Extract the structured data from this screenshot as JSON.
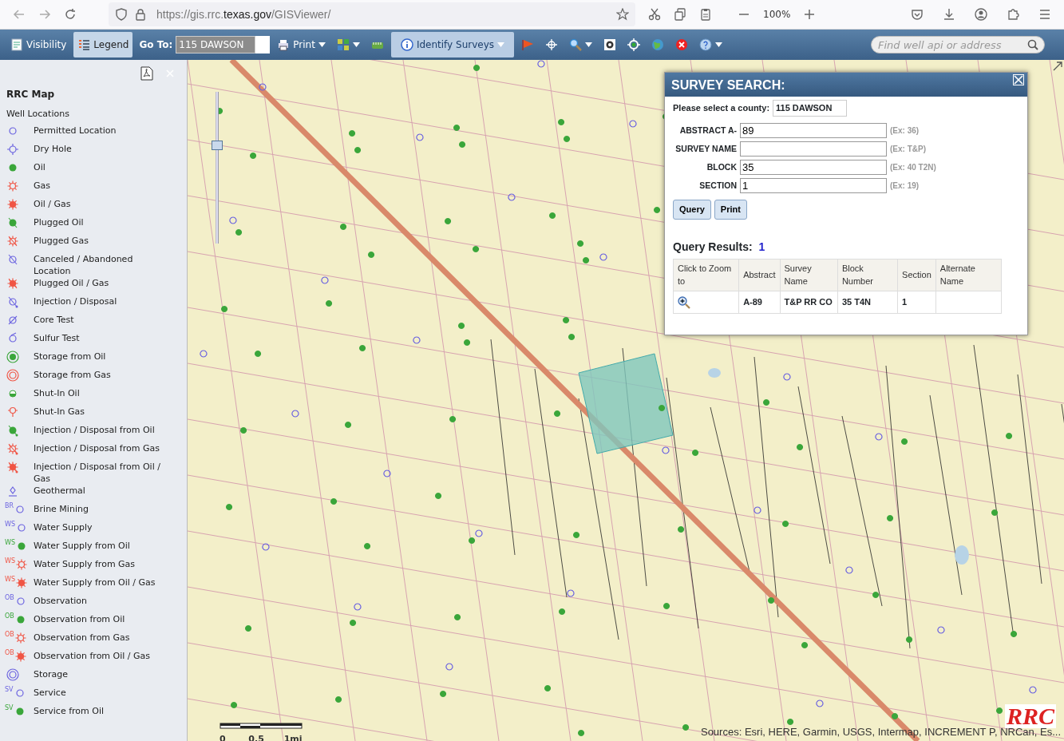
{
  "browser": {
    "url_prefix": "https://gis.rrc.",
    "url_domain": "texas.gov",
    "url_path": "/GISViewer/",
    "zoom": "100%"
  },
  "toolbar": {
    "items": [
      {
        "kind": "visibility",
        "label": "Visibility",
        "selected": false
      },
      {
        "kind": "legend",
        "label": "Legend",
        "selected": true
      }
    ],
    "goto": {
      "label": "Go To:",
      "value": "115 DAWSON"
    },
    "tools": [
      {
        "kind": "print",
        "label": "Print",
        "dropdown": true,
        "selected": false
      },
      {
        "kind": "grid",
        "dropdown": true,
        "selected": false
      },
      {
        "kind": "ruler",
        "dropdown": false,
        "selected": false
      },
      {
        "kind": "info",
        "label": "Identify Surveys",
        "dropdown": true,
        "selected": true
      },
      {
        "kind": "flag",
        "dropdown": false,
        "selected": false
      },
      {
        "kind": "crosshair",
        "dropdown": false,
        "selected": false
      },
      {
        "kind": "zoom",
        "dropdown": true,
        "selected": false
      },
      {
        "kind": "extent",
        "dropdown": false,
        "selected": false
      },
      {
        "kind": "locate",
        "dropdown": false,
        "selected": false
      },
      {
        "kind": "globe",
        "dropdown": false,
        "selected": false
      },
      {
        "kind": "clear",
        "dropdown": false,
        "selected": false
      },
      {
        "kind": "help",
        "dropdown": true,
        "selected": false
      }
    ],
    "search": {
      "placeholder": "Find well api or address"
    }
  },
  "legend": {
    "title": "RRC Map",
    "group": "Well Locations",
    "items": [
      {
        "kind": "hollow",
        "label": "Permitted Location"
      },
      {
        "kind": "dry",
        "label": "Dry Hole"
      },
      {
        "kind": "oil",
        "label": "Oil"
      },
      {
        "kind": "gas",
        "label": "Gas"
      },
      {
        "kind": "oilgas",
        "label": "Oil / Gas"
      },
      {
        "kind": "plugged_oil",
        "label": "Plugged Oil"
      },
      {
        "kind": "plugged_gas",
        "label": "Plugged Gas"
      },
      {
        "kind": "canceled",
        "label": "Canceled / Abandoned Location"
      },
      {
        "kind": "plugged_oilgas",
        "label": "Plugged Oil / Gas"
      },
      {
        "kind": "injection",
        "label": "Injection / Disposal"
      },
      {
        "kind": "core",
        "label": "Core Test"
      },
      {
        "kind": "sulfur",
        "label": "Sulfur Test"
      },
      {
        "kind": "storage_oil",
        "label": "Storage from Oil"
      },
      {
        "kind": "storage_gas",
        "label": "Storage from Gas"
      },
      {
        "kind": "shutin_oil",
        "label": "Shut-In Oil"
      },
      {
        "kind": "shutin_gas",
        "label": "Shut-In Gas"
      },
      {
        "kind": "inj_oil",
        "label": "Injection / Disposal from Oil"
      },
      {
        "kind": "inj_gas",
        "label": "Injection / Disposal from Gas"
      },
      {
        "kind": "inj_oilgas",
        "label": "Injection / Disposal from Oil / Gas"
      },
      {
        "kind": "geothermal",
        "label": "Geothermal"
      },
      {
        "kind": "hollow",
        "tag": "BR",
        "label": "Brine Mining"
      },
      {
        "kind": "hollow",
        "tag": "WS",
        "label": "Water Supply"
      },
      {
        "kind": "oil",
        "tag": "WS",
        "label": "Water Supply from Oil"
      },
      {
        "kind": "gas",
        "tag": "WS",
        "label": "Water Supply from Gas"
      },
      {
        "kind": "oilgas",
        "tag": "WS",
        "label": "Water Supply from Oil / Gas"
      },
      {
        "kind": "hollow",
        "tag": "OB",
        "label": "Observation"
      },
      {
        "kind": "oil",
        "tag": "OB",
        "label": "Observation from Oil"
      },
      {
        "kind": "gas",
        "tag": "OB",
        "label": "Observation from Gas"
      },
      {
        "kind": "oilgas",
        "tag": "OB",
        "label": "Observation from Oil / Gas"
      },
      {
        "kind": "storage",
        "label": "Storage"
      },
      {
        "kind": "hollow",
        "tag": "SV",
        "label": "Service"
      },
      {
        "kind": "oil",
        "tag": "SV",
        "label": "Service from Oil"
      }
    ]
  },
  "map": {
    "zoom_slider": {
      "level": 0.66
    },
    "scale": [
      "0",
      "0.5",
      "1mi"
    ],
    "attribution": "Sources: Esri, HERE, Garmin, USGS, Intermap, INCREMENT P, NRCan, Es...",
    "logo": "RRC"
  },
  "dialog": {
    "title": "SURVEY SEARCH:",
    "county": {
      "label": "Please select a county:",
      "value": "115 DAWSON"
    },
    "fields": [
      {
        "label": "ABSTRACT A-",
        "value": "89",
        "hint": "(Ex: 36)"
      },
      {
        "label": "SURVEY NAME",
        "hint": "(Ex: T&P)"
      },
      {
        "label": "BLOCK",
        "value": "35",
        "hint": "(Ex: 40 T2N)"
      },
      {
        "label": "SECTION",
        "value": "1",
        "hint": "(Ex: 19)"
      }
    ],
    "buttons": [
      "Query",
      "Print"
    ],
    "results_label": "Query Results:",
    "results_count": "1",
    "columns": [
      "Click to Zoom to",
      "Abstract",
      "Survey Name",
      "Block Number",
      "Section",
      "Alternate Name"
    ],
    "rows": [
      [
        "",
        "A-89",
        "T&P RR CO",
        "35 T4N",
        "1",
        ""
      ]
    ]
  }
}
